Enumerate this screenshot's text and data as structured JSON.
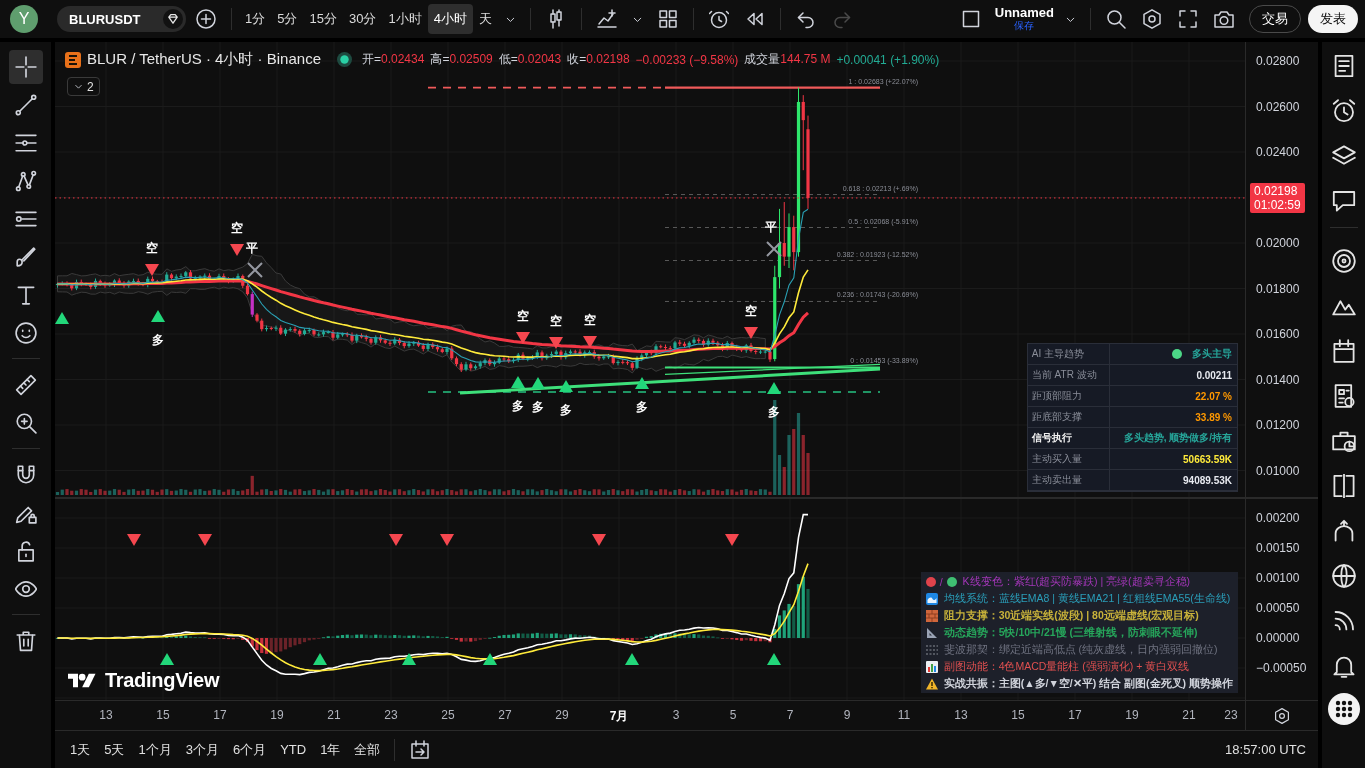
{
  "top_toolbar": {
    "avatar": "Y",
    "symbol": "BLURUSDT",
    "intervals": [
      {
        "label": "1分",
        "selected": false
      },
      {
        "label": "5分",
        "selected": false
      },
      {
        "label": "15分",
        "selected": false
      },
      {
        "label": "30分",
        "selected": false
      },
      {
        "label": "1小时",
        "selected": false
      },
      {
        "label": "4小时",
        "selected": true
      },
      {
        "label": "天",
        "selected": false
      }
    ],
    "history": [
      {
        "kind": "undo",
        "disabled": false
      },
      {
        "kind": "redo",
        "disabled": true
      }
    ],
    "layout": {
      "name": "Unnamed",
      "status": "保存"
    },
    "buttons": [
      {
        "label": "交易",
        "kind": "outline"
      },
      {
        "label": "发表",
        "kind": "primary"
      }
    ]
  },
  "left_toolbar": {
    "tools": [
      {
        "selected": true
      },
      {
        "selected": false
      },
      {
        "selected": false
      },
      {
        "selected": false
      },
      {
        "selected": false
      },
      {
        "selected": false
      },
      {
        "selected": false
      },
      {
        "selected": false
      },
      {
        "selected": false
      },
      {
        "selected": false
      },
      {
        "selected": false
      },
      {
        "selected": false
      },
      {
        "selected": false
      },
      {
        "selected": false
      },
      {
        "selected": false
      }
    ]
  },
  "legend": {
    "title": "BLUR / TetherUS · 4小时 · Binance",
    "falling": true,
    "ohlc": [
      {
        "label": "开=",
        "value": "0.02434"
      },
      {
        "label": "高=",
        "value": "0.02509"
      },
      {
        "label": "低=",
        "value": "0.02043"
      },
      {
        "label": "收=",
        "value": "0.02198"
      }
    ],
    "change": "−0.00233 (−9.58%)",
    "volume": {
      "label": "成交量",
      "value": "144.75 M",
      "change": "+0.00041 (+1.90%)",
      "falling": false
    },
    "collapsed_count": "2"
  },
  "main_chart": {
    "signals": [
      {
        "kind": "long"
      },
      {
        "kind": "short",
        "label": "空"
      },
      {
        "kind": "long",
        "label": "多"
      },
      {
        "kind": "short",
        "label": "空"
      },
      {
        "kind": "close",
        "label": "平"
      },
      {
        "kind": "long",
        "label": "多"
      },
      {
        "kind": "short",
        "label": "空"
      },
      {
        "kind": "long",
        "label": "多"
      },
      {
        "kind": "short",
        "label": "空"
      },
      {
        "kind": "long",
        "label": "多"
      },
      {
        "kind": "short",
        "label": "空"
      },
      {
        "kind": "long",
        "label": "多"
      },
      {
        "kind": "short",
        "label": "空"
      },
      {
        "kind": "close",
        "label": "平"
      },
      {
        "kind": "long",
        "label": "多"
      }
    ],
    "fib_levels": [
      "1 : 0.02683 (+22.07%)",
      "0.618 : 0.02213 (+.69%)",
      "0.5 : 0.02068 (-5.91%)",
      "0.382 : 0.01923 (-12.52%)",
      "0.236 : 0.01743 (-20.69%)",
      "0 : 0.01453 (-33.89%)"
    ],
    "price_axis": [
      "0.02800",
      "0.02600",
      "0.02400",
      "0.02000",
      "0.01800",
      "0.01600",
      "0.01400",
      "0.01200",
      "0.01000"
    ],
    "last_price": {
      "value": "0.02198",
      "countdown": "01:02:59"
    },
    "trend_table": [
      {
        "label": "AI 主导趋势",
        "value": "多头主导",
        "color": "#26a69a",
        "dot": true,
        "emphasis": false
      },
      {
        "label": "当前 ATR 波动",
        "value": "0.00211",
        "color": "#e8eaf0",
        "dot": false,
        "emphasis": false
      },
      {
        "label": "距顶部阻力",
        "value": "22.07 %",
        "color": "#ff9800",
        "dot": false,
        "emphasis": false
      },
      {
        "label": "距底部支撑",
        "value": "33.89 %",
        "color": "#ff9800",
        "dot": false,
        "emphasis": false
      },
      {
        "label": "信号执行",
        "value": "多头趋势, 顺势做多/持有",
        "color": "#26a69a",
        "dot": false,
        "emphasis": true
      },
      {
        "label": "主动买入量",
        "value": "50663.59K",
        "color": "#ffeb3b",
        "dot": false,
        "emphasis": false
      },
      {
        "label": "主动卖出量",
        "value": "94089.53K",
        "color": "#e8eaf0",
        "dot": false,
        "emphasis": false
      }
    ]
  },
  "macd_pane": {
    "signals": [
      {
        "kind": "short"
      },
      {
        "kind": "long"
      },
      {
        "kind": "short"
      },
      {
        "kind": "long"
      },
      {
        "kind": "short"
      },
      {
        "kind": "long"
      },
      {
        "kind": "short"
      },
      {
        "kind": "long"
      },
      {
        "kind": "short"
      },
      {
        "kind": "long"
      },
      {
        "kind": "short"
      },
      {
        "kind": "long"
      }
    ],
    "price_axis": [
      "0.00200",
      "0.00150",
      "0.00100",
      "0.00050",
      "0.00000",
      "−0.00050"
    ],
    "notes": [
      {
        "kind": "dots",
        "separator": "/",
        "text": "K线变色：紫红(超买防暴跌) | 亮绿(超卖寻企稳)",
        "color": "#a336b8",
        "bold": false
      },
      {
        "kind": "wave",
        "text": "均线系统：蓝线EMA8 | 黄线EMA21 | 红粗线EMA55(生命线)",
        "color": "#2a9db8",
        "bold": false
      },
      {
        "kind": "brick",
        "text": "阻力支撑：30近端实线(波段) | 80远端虚线(宏观目标)",
        "color": "#c8b23a",
        "bold": true
      },
      {
        "kind": "ruler",
        "text": "动态趋势：5快/10中/21慢 (三维射线，防刺眼不延伸)",
        "color": "#26a65b",
        "bold": true
      },
      {
        "kind": "fib",
        "text": "斐波那契：绑定近端高低点 (纯灰虚线，日内强弱回撤位)",
        "color": "#6f7280",
        "bold": false
      },
      {
        "kind": "chart",
        "text": "副图动能：4色MACD量能柱 (强弱演化) + 黄白双线",
        "color": "#e05050",
        "bold": false
      },
      {
        "kind": "warning",
        "text": "实战共振：主图(▲多/▼空/✕平) 结合 副图(金死叉) 顺势操作",
        "color": "#d1d4dc",
        "bold": true
      }
    ],
    "logo": "TradingView"
  },
  "time_axis": [
    {
      "label": "13",
      "kind": "day"
    },
    {
      "label": "15",
      "kind": "day"
    },
    {
      "label": "17",
      "kind": "day"
    },
    {
      "label": "19",
      "kind": "day"
    },
    {
      "label": "21",
      "kind": "day"
    },
    {
      "label": "23",
      "kind": "day"
    },
    {
      "label": "25",
      "kind": "day"
    },
    {
      "label": "27",
      "kind": "day"
    },
    {
      "label": "29",
      "kind": "day"
    },
    {
      "label": "7月",
      "kind": "month"
    },
    {
      "label": "3",
      "kind": "day"
    },
    {
      "label": "5",
      "kind": "day"
    },
    {
      "label": "7",
      "kind": "day"
    },
    {
      "label": "9",
      "kind": "day"
    },
    {
      "label": "11",
      "kind": "day"
    },
    {
      "label": "13",
      "kind": "day"
    },
    {
      "label": "15",
      "kind": "day"
    },
    {
      "label": "17",
      "kind": "day"
    },
    {
      "label": "19",
      "kind": "day"
    },
    {
      "label": "21",
      "kind": "day"
    },
    {
      "label": "23",
      "kind": "day"
    }
  ],
  "range_bar": {
    "ranges": [
      "1天",
      "5天",
      "1个月",
      "3个月",
      "6个月",
      "YTD",
      "1年",
      "全部"
    ],
    "clock": "18:57:00 UTC"
  }
}
